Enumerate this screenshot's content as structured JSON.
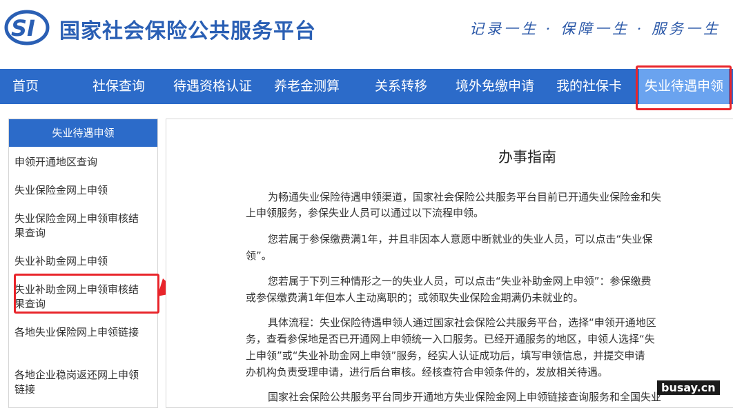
{
  "header": {
    "logo_text": "SI",
    "title": "国家社会保险公共服务平台",
    "slogan": "记录一生 · 保障一生 · 服务一生"
  },
  "nav": {
    "items": [
      {
        "label": "首页"
      },
      {
        "label": "社保查询"
      },
      {
        "label": "待遇资格认证"
      },
      {
        "label": "养老金测算"
      },
      {
        "label": "关系转移"
      },
      {
        "label": "境外免缴申请"
      },
      {
        "label": "我的社保卡"
      },
      {
        "label": "失业待遇申领"
      }
    ]
  },
  "sidebar": {
    "header": "失业待遇申领",
    "items": [
      {
        "label": "申领开通地区查询"
      },
      {
        "label": "失业保险金网上申领"
      },
      {
        "label": "失业保险金网上申领审核结果查询"
      },
      {
        "label": "失业补助金网上申领"
      },
      {
        "label": "失业补助金网上申领审核结果查询"
      },
      {
        "label": "各地失业保险网上申领链接"
      },
      {
        "label": "各地企业稳岗返还网上申领链接"
      }
    ]
  },
  "content": {
    "title": "办事指南",
    "lines": [
      "为畅通失业保险待遇申领渠道，国家社会保险公共服务平台目前已开通失业保险金和失",
      "上申领服务，参保失业人员可以通过以下流程申领。",
      "您若属于参保缴费满1年，并且非因本人意愿中断就业的失业人员，可以点击“失业保",
      "领”。",
      "您若属于下列三种情形之一的失业人员，可以点击“失业补助金网上申领”：参保缴费",
      "或参保缴费满1年但本人主动离职的；或领取失业保险金期满仍未就业的。",
      "具体流程：失业保险待遇申领人通过国家社会保险公共服务平台，选择“申领开通地区",
      "务，查看参保地是否已开通网上申领统一入口服务。已经开通服务的地区，申领人选择“失",
      "上申领”或“失业补助金网上申领”服务，经实人认证成功后，填写申领信息，并提交申请",
      "办机构负责受理申请，进行后台审核。经核查符合申领条件的，发放相关待遇。",
      "国家社会保险公共服务平台同步开通地方失业保险金网上申领链接查询服务和全国失业"
    ]
  },
  "watermark": "busay.cn",
  "colors": {
    "brand_blue": "#2c6bc9",
    "highlight_red": "#e8242a",
    "active_tab": "#6aa3ef"
  }
}
